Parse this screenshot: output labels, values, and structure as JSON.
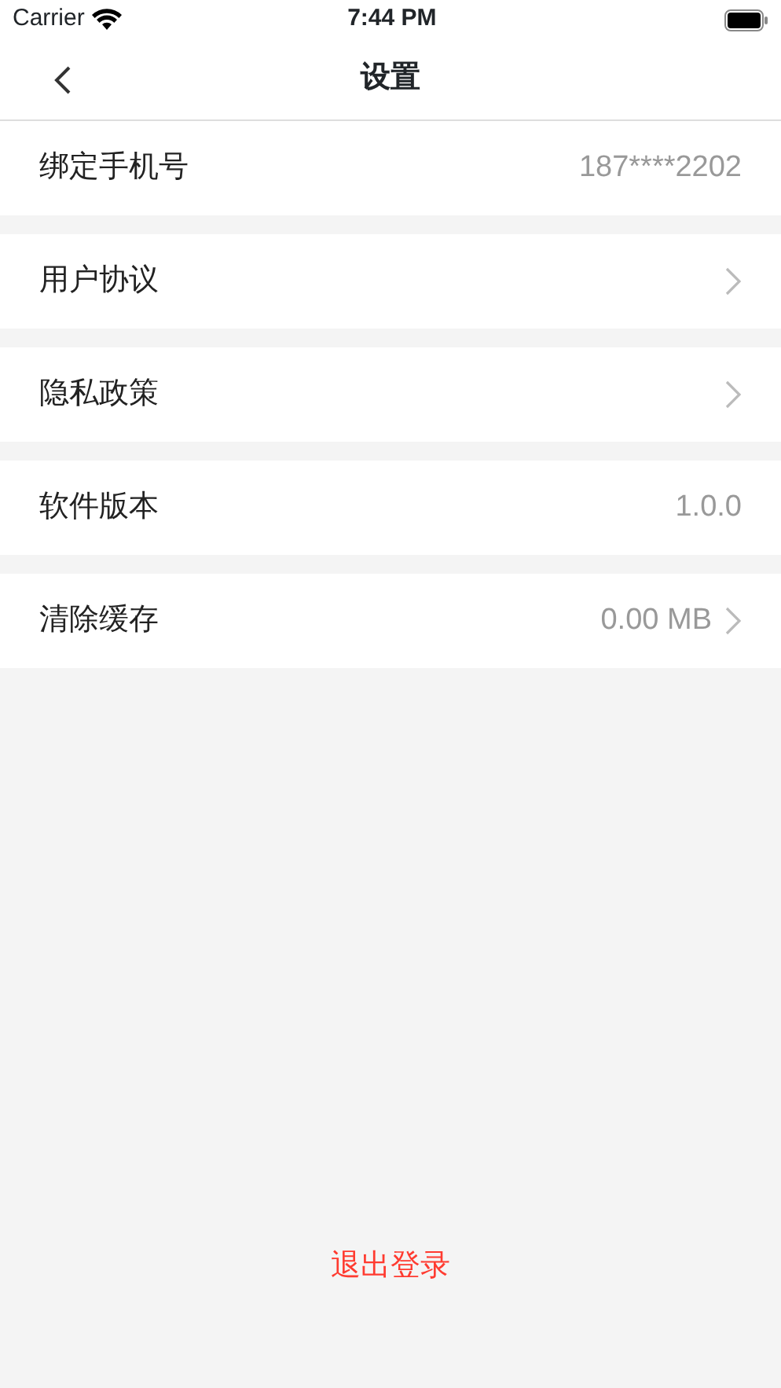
{
  "status_bar": {
    "carrier": "Carrier",
    "time": "7:44 PM"
  },
  "nav_bar": {
    "title": "设置"
  },
  "rows": [
    {
      "label": "绑定手机号",
      "value": "187****2202",
      "chevron": false
    },
    {
      "label": "用户协议",
      "chevron": true
    },
    {
      "label": "隐私政策",
      "chevron": true
    },
    {
      "label": "软件版本",
      "value": "1.0.0",
      "chevron": false
    },
    {
      "label": "清除缓存",
      "value": "0.00 MB",
      "chevron": true
    }
  ],
  "logout_button": "退出登录"
}
